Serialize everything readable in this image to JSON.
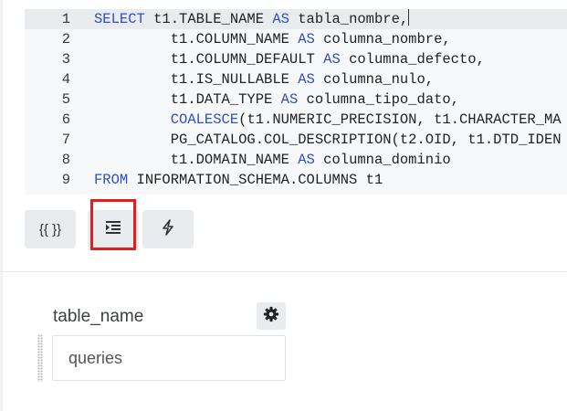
{
  "editor": {
    "lines": [
      {
        "n": "1",
        "parts": [
          {
            "t": "SELECT",
            "kw": true
          },
          {
            "t": " t1.TABLE_NAME "
          },
          {
            "t": "AS",
            "kw": true
          },
          {
            "t": " tabla_nombre,"
          }
        ]
      },
      {
        "n": "2",
        "parts": [
          {
            "t": "         t1.COLUMN_NAME "
          },
          {
            "t": "AS",
            "kw": true
          },
          {
            "t": " columna_nombre,"
          }
        ]
      },
      {
        "n": "3",
        "parts": [
          {
            "t": "         t1.COLUMN_DEFAULT "
          },
          {
            "t": "AS",
            "kw": true
          },
          {
            "t": " columna_defecto,"
          }
        ]
      },
      {
        "n": "4",
        "parts": [
          {
            "t": "         t1.IS_NULLABLE "
          },
          {
            "t": "AS",
            "kw": true
          },
          {
            "t": " columna_nulo,"
          }
        ]
      },
      {
        "n": "5",
        "parts": [
          {
            "t": "         t1.DATA_TYPE "
          },
          {
            "t": "AS",
            "kw": true
          },
          {
            "t": " columna_tipo_dato,"
          }
        ]
      },
      {
        "n": "6",
        "parts": [
          {
            "t": "         "
          },
          {
            "t": "COALESCE",
            "kw": true
          },
          {
            "t": "(t1.NUMERIC_PRECISION, t1.CHARACTER_MA"
          }
        ]
      },
      {
        "n": "7",
        "parts": [
          {
            "t": "         PG_CATALOG.COL_DESCRIPTION(t2.OID, t1.DTD_IDEN"
          }
        ]
      },
      {
        "n": "8",
        "parts": [
          {
            "t": "         t1.DOMAIN_NAME "
          },
          {
            "t": "AS",
            "kw": true
          },
          {
            "t": " columna_dominio"
          }
        ]
      },
      {
        "n": "9",
        "parts": [
          {
            "t": "FROM",
            "kw": true
          },
          {
            "t": " INFORMATION_SCHEMA.COLUMNS t1"
          }
        ]
      }
    ]
  },
  "toolbar": {
    "variables_label": "{{ }}",
    "format_icon": "indent-format-icon",
    "run_icon": "lightning-icon"
  },
  "parameter": {
    "label": "table_name",
    "value": "queries",
    "settings_icon": "gear-icon"
  },
  "colors": {
    "keyword": "#2d4ec6",
    "editor_bg": "#f6f8fa",
    "button_bg": "#e9ecef",
    "highlight": "#e02020"
  }
}
